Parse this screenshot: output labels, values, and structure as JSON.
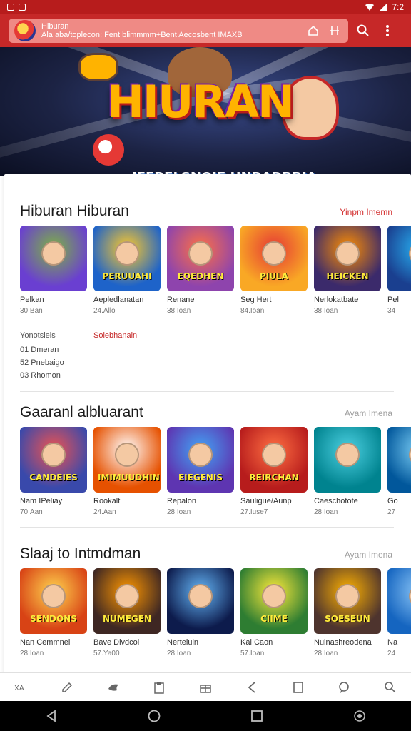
{
  "status_bar": {
    "time": "7:2",
    "battery_icon": "battery-icon",
    "wifi_icon": "wifi-icon",
    "signal_icon": "signal-icon"
  },
  "browser": {
    "page_title": "Hiburan",
    "url_text": "Ala aba/toplecon: Fent blimmmm+Bent Aecosbent IMAXB",
    "home_icon": "home-icon",
    "tabs_icon": "tabs-icon",
    "search_icon": "search-icon",
    "menu_icon": "more-vert-icon"
  },
  "hero": {
    "title": "HIURAN",
    "subtitle": "IFERELSNOIE HNRADRRIA"
  },
  "sections": [
    {
      "title": "Hiburan Hiburan",
      "more_label": "Yinpm Imemn",
      "more_color": "#d32f2f",
      "cards": [
        {
          "name": "Pelkan",
          "meta": "30.Ban",
          "thumb_text": "",
          "bg": "#6a3fd1",
          "accent": "#7cb342"
        },
        {
          "name": "Aepledlanatan",
          "meta": "24.Allo",
          "thumb_text": "PERUUAHI",
          "bg": "#1e63c9",
          "accent": "#ffca28"
        },
        {
          "name": "Renane",
          "meta": "38.Ioan",
          "thumb_text": "EQEDHEN",
          "bg": "#8e44ad",
          "accent": "#ff7043"
        },
        {
          "name": "Seg Hert",
          "meta": "84.Ioan",
          "thumb_text": "PIULA",
          "bg": "#f9a825",
          "accent": "#e53935"
        },
        {
          "name": "Nerlokatbate",
          "meta": "38.Ioan",
          "thumb_text": "HEICKEN",
          "bg": "#3b2a6b",
          "accent": "#ff8f00"
        },
        {
          "name": "Pel",
          "meta": "34",
          "thumb_text": "",
          "bg": "#1a3f8f",
          "accent": "#29b6f6"
        }
      ]
    },
    {
      "title": "Gaaranl albluarant",
      "more_label": "Ayam Imena",
      "more_color": "#9e9e9e",
      "cards": [
        {
          "name": "Nam IPeliay",
          "meta": "70.Aan",
          "thumb_text": "CANDEIES",
          "bg": "#3949ab",
          "accent": "#ef5350"
        },
        {
          "name": "Rookalt",
          "meta": "24.Aan",
          "thumb_text": "IMIMUUDHIN",
          "bg": "#e65100",
          "accent": "#ffffff"
        },
        {
          "name": "Repalon",
          "meta": "28.Ioan",
          "thumb_text": "EIEGENIS",
          "bg": "#5e35b1",
          "accent": "#42a5f5"
        },
        {
          "name": "Sauligue/Aunp",
          "meta": "27.Iuse7",
          "thumb_text": "REIRCHAN",
          "bg": "#b71c1c",
          "accent": "#ff7043"
        },
        {
          "name": "Caeschotote",
          "meta": "28.Ioan",
          "thumb_text": "",
          "bg": "#00838f",
          "accent": "#4dd0e1"
        },
        {
          "name": "Go",
          "meta": "27",
          "thumb_text": "",
          "bg": "#01579b",
          "accent": "#81d4fa"
        }
      ]
    },
    {
      "title": "Slaaj to Intmdman",
      "more_label": "Ayam Imena",
      "more_color": "#9e9e9e",
      "cards": [
        {
          "name": "Nan Cemmnel",
          "meta": "28.Ioan",
          "thumb_text": "SENDONS",
          "bg": "#d84315",
          "accent": "#ffd54f"
        },
        {
          "name": "Bave Divdcol",
          "meta": "57.Ya00",
          "thumb_text": "NUMEGEN",
          "bg": "#3e2723",
          "accent": "#ff9800"
        },
        {
          "name": "Nerteluin",
          "meta": "28.Ioan",
          "thumb_text": "",
          "bg": "#0d1b4c",
          "accent": "#64b5f6"
        },
        {
          "name": "Kal Caon",
          "meta": "57.Ioan",
          "thumb_text": "CIIME",
          "bg": "#2e7d32",
          "accent": "#ffeb3b"
        },
        {
          "name": "Nulnashreodena",
          "meta": "28.Ioan",
          "thumb_text": "SOESEUN",
          "bg": "#4e342e",
          "accent": "#ffb300"
        },
        {
          "name": "Na",
          "meta": "24",
          "thumb_text": "",
          "bg": "#1565c0",
          "accent": "#90caf9"
        }
      ]
    }
  ],
  "info": {
    "label": "Yonotsiels",
    "link": "Solebhanain",
    "lines": [
      "01 Dmeran",
      "52 Pnebaigo",
      "03 Rhomon"
    ]
  },
  "bottom_toolbar": [
    "translate-icon",
    "edit-icon",
    "bird-icon",
    "clipboard-icon",
    "gift-icon",
    "back-icon",
    "square-icon",
    "chat-icon",
    "search-icon"
  ],
  "nav_bar": [
    "back-triangle-icon",
    "home-circle-icon",
    "recents-square-icon",
    "assistant-icon"
  ]
}
